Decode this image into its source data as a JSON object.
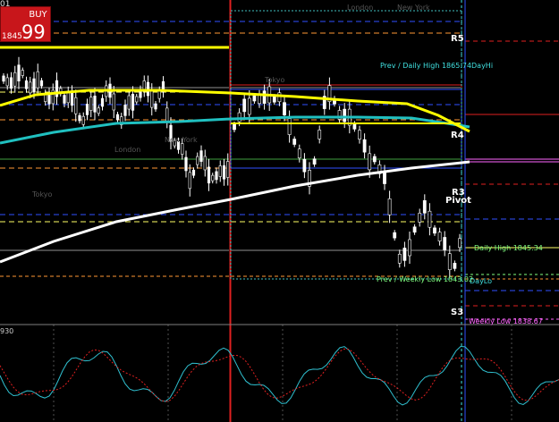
{
  "trade_panel": {
    "symbol_fragment": "01",
    "buy_label": "BUY",
    "price_small": "1845",
    "price_big": "99"
  },
  "pivots": {
    "r5": "R5",
    "r4": "R4",
    "r3": "R3",
    "pivot": "Pivot",
    "s3": "S3"
  },
  "annotations": {
    "prev_daily_high": "Prev / Daily High 1865.74",
    "day_hi": "DayHi",
    "daily_high": "Daily High 1845.34",
    "prev_weekly_low": "Prev / Weekly Low 1843.02",
    "day_lo": "DayLo",
    "weekly_low": "Weekly Low 1838.67"
  },
  "sessions": {
    "london_1": "London",
    "new_york_1": "New York",
    "london_2": "London",
    "new_york_2": "New York",
    "tokyo_1": "Tokyo",
    "tokyo_2": "Tokyo"
  },
  "oscillator": {
    "value_fragment": "930"
  },
  "colors": {
    "background": "#000000",
    "buy_button": "#c8161b",
    "ma_yellow": "#ffff00",
    "ma_cyan": "#20c0c0",
    "ma_white": "#ffffff",
    "candles": "#ffffff",
    "signal_red": "#e02020",
    "pivot_magenta": "#ff66ff",
    "label_cyan": "#40e0e0",
    "label_green": "#80ff80",
    "session_grey": "#606060"
  }
}
